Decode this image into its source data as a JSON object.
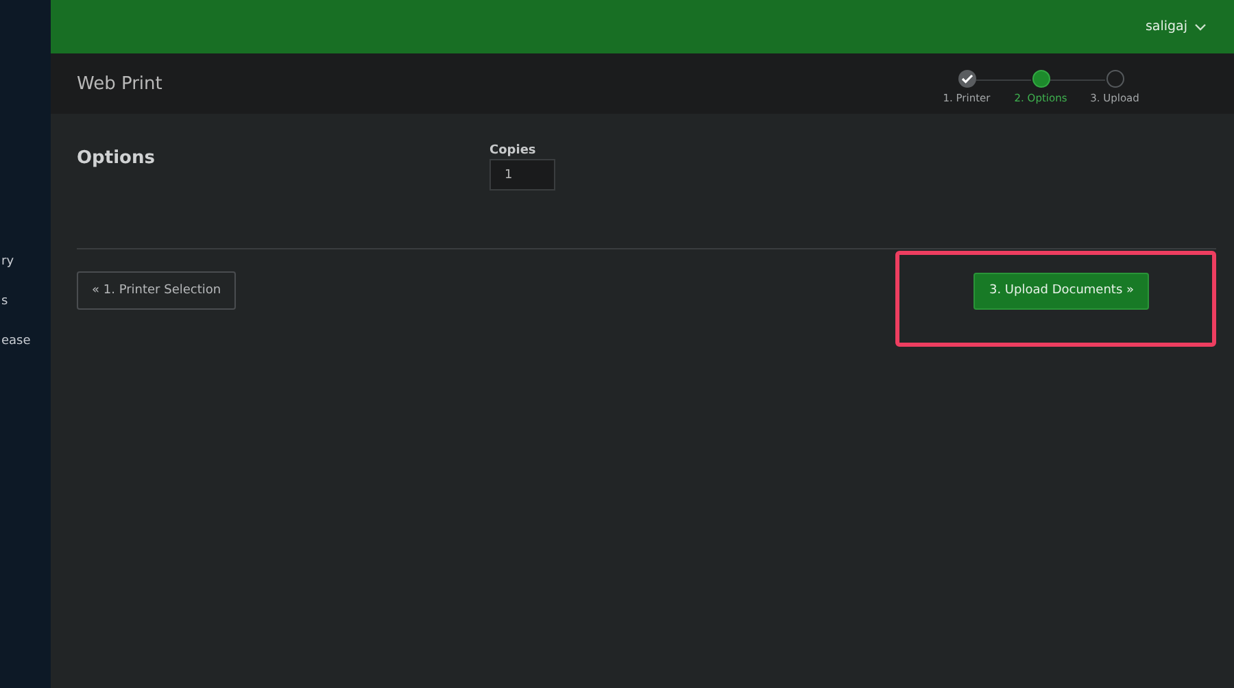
{
  "sidebar": {
    "items": [
      {
        "label": "ry"
      },
      {
        "label": "s"
      },
      {
        "label": "ease"
      }
    ]
  },
  "top_bar": {
    "user": "saligaj"
  },
  "header": {
    "title": "Web Print",
    "steps": [
      {
        "label": "1. Printer",
        "done": true,
        "selected": false
      },
      {
        "label": "2. Options",
        "done": false,
        "selected": true
      },
      {
        "label": "3. Upload",
        "done": false,
        "selected": false
      }
    ]
  },
  "section": {
    "title": "Options",
    "copies": {
      "label": "Copies",
      "value": "1"
    }
  },
  "buttons": {
    "back": {
      "label": "« 1. Printer Selection"
    },
    "next": {
      "label": "3. Upload Documents »",
      "highlighted": true
    }
  }
}
